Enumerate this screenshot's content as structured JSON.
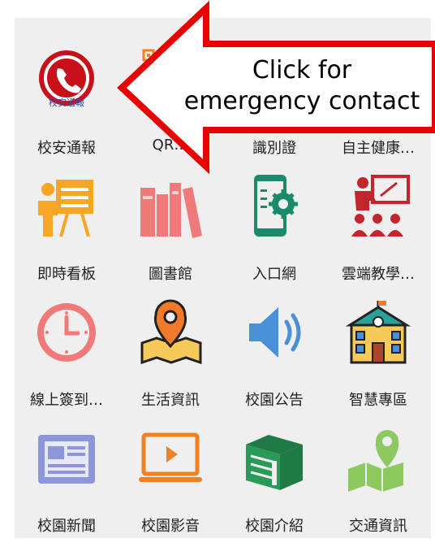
{
  "grid": {
    "items": [
      {
        "label": "校安通報",
        "icon": "emergency-phone-icon",
        "icon_text": "校安通報"
      },
      {
        "label": "QR…",
        "icon": "qr-code-icon"
      },
      {
        "label": "識別證",
        "icon": "id-card-icon"
      },
      {
        "label": "自主健康…",
        "icon": "health-icon"
      },
      {
        "label": "即時看板",
        "icon": "presentation-board-icon"
      },
      {
        "label": "圖書館",
        "icon": "library-books-icon"
      },
      {
        "label": "入口網",
        "icon": "mobile-portal-gear-icon"
      },
      {
        "label": "雲端教學…",
        "icon": "cloud-teaching-classroom-icon"
      },
      {
        "label": "線上簽到…",
        "icon": "clock-icon"
      },
      {
        "label": "生活資訊",
        "icon": "map-pin-icon"
      },
      {
        "label": "校園公告",
        "icon": "speaker-icon"
      },
      {
        "label": "智慧專區",
        "icon": "school-building-icon"
      },
      {
        "label": "校園新聞",
        "icon": "newspaper-icon"
      },
      {
        "label": "校園影音",
        "icon": "video-monitor-icon"
      },
      {
        "label": "校園介紹",
        "icon": "campus-book-icon"
      },
      {
        "label": "交通資訊",
        "icon": "map-location-icon"
      }
    ]
  },
  "callout": {
    "line1": "Click for",
    "line2": "emergency contact",
    "arrow_color": "#e60000"
  }
}
